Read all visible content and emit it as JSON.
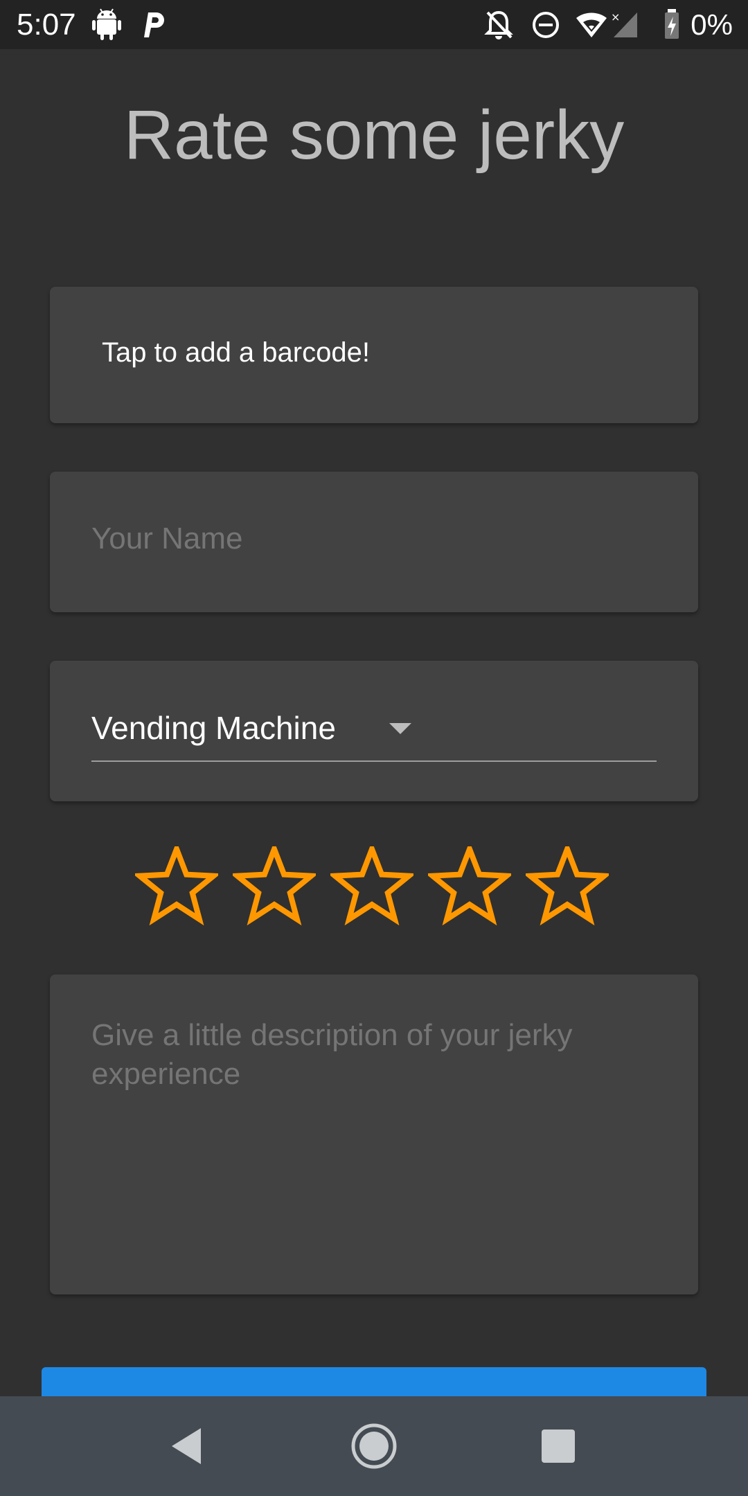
{
  "status_bar": {
    "time": "5:07",
    "battery_percent": "0%",
    "icons": [
      "android-icon",
      "parking-app-icon",
      "notifications-off-icon",
      "do-not-disturb-icon",
      "wifi-icon",
      "cell-signal-icon",
      "battery-charging-icon"
    ]
  },
  "page": {
    "title": "Rate some jerky"
  },
  "barcode": {
    "label": "Tap to add a barcode!"
  },
  "name_field": {
    "placeholder": "Your Name",
    "value": ""
  },
  "source_dropdown": {
    "selected": "Vending Machine"
  },
  "rating": {
    "max": 5,
    "value": 0,
    "star_color": "#FF9800"
  },
  "description_field": {
    "placeholder": "Give a little description of your jerky experience",
    "value": ""
  },
  "colors": {
    "background": "#303030",
    "card": "#424242",
    "accent_button": "#1E88E5",
    "nav_bar": "#444B52"
  },
  "nav_bar": {
    "buttons": [
      "back-icon",
      "home-icon",
      "recents-icon"
    ]
  }
}
